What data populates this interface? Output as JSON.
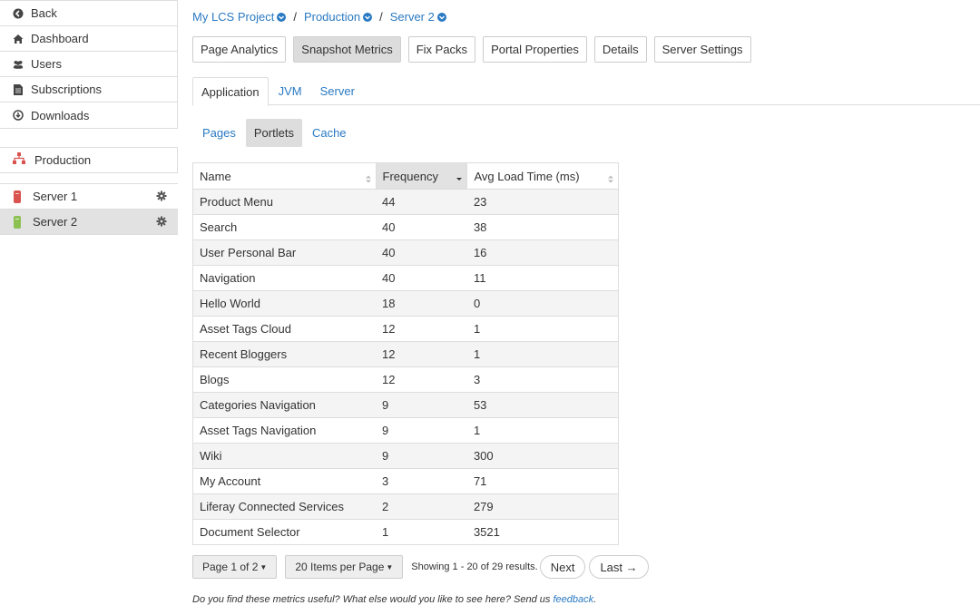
{
  "sidebar": {
    "nav": [
      {
        "label": "Back",
        "icon": "back-circle-icon"
      },
      {
        "label": "Dashboard",
        "icon": "home-icon"
      },
      {
        "label": "Users",
        "icon": "users-icon"
      },
      {
        "label": "Subscriptions",
        "icon": "document-icon"
      },
      {
        "label": "Downloads",
        "icon": "download-circle-icon"
      }
    ],
    "environment": {
      "label": "Production",
      "icon": "environment-icon",
      "color": "#d9534f"
    },
    "servers": [
      {
        "label": "Server 1",
        "status_color": "#d9534f"
      },
      {
        "label": "Server 2",
        "status_color": "#8cc152"
      }
    ]
  },
  "breadcrumb": {
    "project": "My LCS Project",
    "environment": "Production",
    "server": "Server 2",
    "separator": "/"
  },
  "top_buttons": [
    {
      "label": "Page Analytics",
      "active": false
    },
    {
      "label": "Snapshot Metrics",
      "active": true
    },
    {
      "label": "Fix Packs",
      "active": false
    },
    {
      "label": "Portal Properties",
      "active": false
    },
    {
      "label": "Details",
      "active": false
    },
    {
      "label": "Server Settings",
      "active": false
    }
  ],
  "tabs": [
    {
      "label": "Application",
      "active": true
    },
    {
      "label": "JVM",
      "active": false
    },
    {
      "label": "Server",
      "active": false
    }
  ],
  "subtabs": [
    {
      "label": "Pages",
      "active": false
    },
    {
      "label": "Portlets",
      "active": true
    },
    {
      "label": "Cache",
      "active": false
    }
  ],
  "table": {
    "headers": [
      "Name",
      "Frequency",
      "Avg Load Time (ms)"
    ],
    "rows": [
      [
        "Product Menu",
        "44",
        "23"
      ],
      [
        "Search",
        "40",
        "38"
      ],
      [
        "User Personal Bar",
        "40",
        "16"
      ],
      [
        "Navigation",
        "40",
        "11"
      ],
      [
        "Hello World",
        "18",
        "0"
      ],
      [
        "Asset Tags Cloud",
        "12",
        "1"
      ],
      [
        "Recent Bloggers",
        "12",
        "1"
      ],
      [
        "Blogs",
        "12",
        "3"
      ],
      [
        "Categories Navigation",
        "9",
        "53"
      ],
      [
        "Asset Tags Navigation",
        "9",
        "1"
      ],
      [
        "Wiki",
        "9",
        "300"
      ],
      [
        "My Account",
        "3",
        "71"
      ],
      [
        "Liferay Connected Services",
        "2",
        "279"
      ],
      [
        "Document Selector",
        "1",
        "3521"
      ]
    ]
  },
  "pager": {
    "page_label": "Page 1 of 2",
    "items_label": "20 Items per Page",
    "results": "Showing 1 - 20 of 29 results.",
    "next": "Next",
    "last": "Last →"
  },
  "feedback": {
    "text": "Do you find these metrics useful? What else would you like to see here? Send us",
    "link": "feedback",
    "end": "."
  },
  "colors": {
    "link": "#2a7ac3",
    "active_bg": "#dcdcdc"
  }
}
